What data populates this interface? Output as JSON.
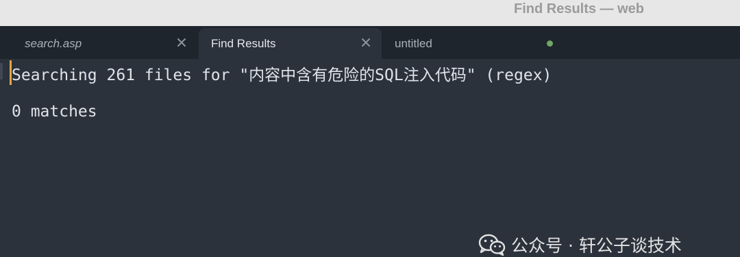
{
  "window": {
    "title": "Find Results — web"
  },
  "tabs": [
    {
      "label": "search.asp",
      "active": false,
      "has_close": true
    },
    {
      "label": "Find Results",
      "active": true,
      "has_close": true
    },
    {
      "label": "untitled",
      "active": false,
      "unsaved": true
    }
  ],
  "editor": {
    "lines": [
      "Searching 261 files for \"内容中含有危险的SQL注入代码\" (regex)",
      "0 matches"
    ]
  },
  "watermark": {
    "text": "公众号 · 轩公子谈技术",
    "icon": "wechat-icon"
  },
  "colors": {
    "editor_bg": "#2b323c",
    "tabbar_bg": "#1f252d",
    "caret": "#e5a44a",
    "unsaved_dot": "#6fa866"
  }
}
